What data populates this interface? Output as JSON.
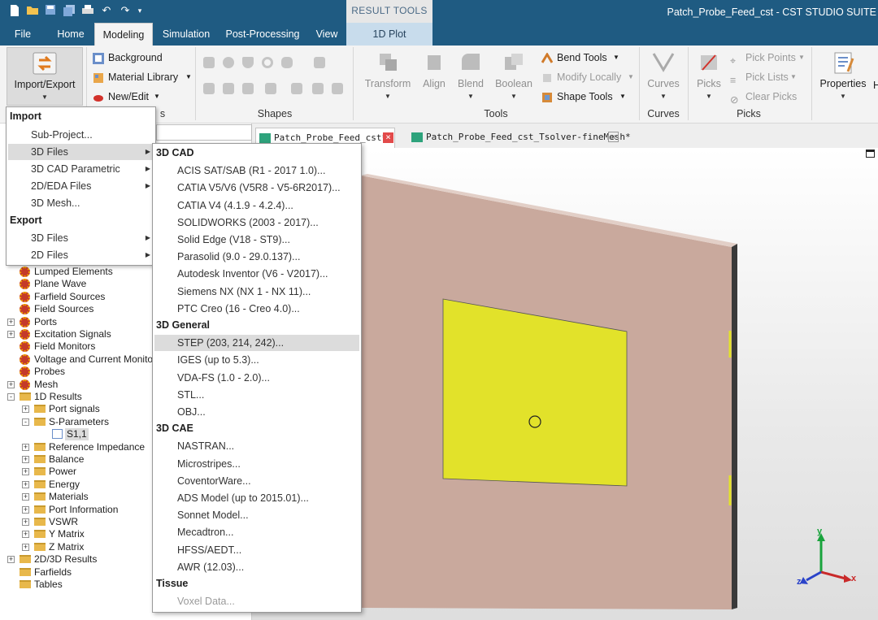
{
  "window": {
    "title": "Patch_Probe_Feed_cst - CST STUDIO SUITE"
  },
  "quick_access": [
    {
      "icon": "new-file-icon"
    },
    {
      "icon": "open-folder-icon"
    },
    {
      "icon": "save-icon"
    },
    {
      "icon": "save-all-icon"
    },
    {
      "icon": "print-icon"
    },
    {
      "icon": "undo-icon"
    },
    {
      "icon": "redo-icon"
    },
    {
      "icon": "customize-icon"
    }
  ],
  "menu": {
    "tabs": [
      "File",
      "Home",
      "Modeling",
      "Simulation",
      "Post-Processing",
      "View"
    ],
    "active": "Modeling"
  },
  "contextual": {
    "label": "RESULT TOOLS",
    "tab": "1D Plot"
  },
  "ribbon": {
    "import_export": "Import/Export",
    "materials": {
      "items": [
        "Background",
        "Material Library",
        "New/Edit"
      ],
      "group": "s"
    },
    "shapes": {
      "group": "Shapes"
    },
    "tools": {
      "group": "Tools",
      "transform": "Transform",
      "align": "Align",
      "blend": "Blend",
      "boolean": "Boolean",
      "bend_tools": "Bend Tools",
      "modify_locally": "Modify Locally",
      "shape_tools": "Shape Tools"
    },
    "curves": {
      "group": "Curves",
      "button": "Curves"
    },
    "picks": {
      "group": "Picks",
      "button": "Picks",
      "pick_points": "Pick Points",
      "pick_lists": "Pick Lists",
      "clear_picks": "Clear Picks"
    },
    "properties": "Properties",
    "overflow": "H"
  },
  "panel_close": "×",
  "tree": [
    {
      "label": "Lumped Elements",
      "icon": "gear-icon"
    },
    {
      "label": "Plane Wave",
      "icon": "gear-icon"
    },
    {
      "label": "Farfield Sources",
      "icon": "gear-icon"
    },
    {
      "label": "Field Sources",
      "icon": "gear-icon"
    },
    {
      "label": "Ports",
      "icon": "gear-icon",
      "exp": "+"
    },
    {
      "label": "Excitation Signals",
      "icon": "gear-icon",
      "exp": "+"
    },
    {
      "label": "Field Monitors",
      "icon": "gear-icon"
    },
    {
      "label": "Voltage and Current Monito",
      "icon": "gear-icon"
    },
    {
      "label": "Probes",
      "icon": "gear-icon"
    },
    {
      "label": "Mesh",
      "icon": "gear-icon",
      "exp": "+"
    },
    {
      "label": "1D Results",
      "icon": "folder-icon",
      "exp": "-"
    },
    {
      "label": "Port signals",
      "icon": "folder-icon",
      "exp": "+"
    },
    {
      "label": "S-Parameters",
      "icon": "folder-icon",
      "exp": "-"
    },
    {
      "label": "S1,1",
      "icon": "chart-icon"
    },
    {
      "label": "Reference Impedance",
      "icon": "folder-icon",
      "exp": "+"
    },
    {
      "label": "Balance",
      "icon": "folder-icon",
      "exp": "+"
    },
    {
      "label": "Power",
      "icon": "folder-icon",
      "exp": "+"
    },
    {
      "label": "Energy",
      "icon": "folder-icon",
      "exp": "+"
    },
    {
      "label": "Materials",
      "icon": "folder-icon",
      "exp": "+"
    },
    {
      "label": "Port Information",
      "icon": "folder-icon",
      "exp": "+"
    },
    {
      "label": "VSWR",
      "icon": "folder-icon",
      "exp": "+"
    },
    {
      "label": "Y Matrix",
      "icon": "folder-icon",
      "exp": "+"
    },
    {
      "label": "Z Matrix",
      "icon": "folder-icon",
      "exp": "+"
    },
    {
      "label": "2D/3D Results",
      "icon": "folder-icon",
      "exp": "+"
    },
    {
      "label": "Farfields",
      "icon": "folder-icon"
    },
    {
      "label": "Tables",
      "icon": "folder-icon"
    }
  ],
  "doc_tabs": [
    {
      "label": "Patch_Probe_Feed_cst*"
    },
    {
      "label": "Patch_Probe_Feed_cst_Tsolver-fineMesh*"
    }
  ],
  "axes": {
    "y": "y",
    "z": "z",
    "x": "x"
  },
  "colors": {
    "title_bar": "#1f5b82",
    "substrate": "#c9a99d",
    "patch": "#e2e22a",
    "highlight": "#dcdcdc"
  },
  "import_menu": {
    "import_header": "Import",
    "import_items": [
      "Sub-Project...",
      "3D Files",
      "3D CAD Parametric",
      "2D/EDA Files",
      "3D Mesh..."
    ],
    "export_header": "Export",
    "export_items": [
      "3D Files",
      "2D Files"
    ]
  },
  "submenu": {
    "cad_header": "3D CAD",
    "cad": [
      "ACIS SAT/SAB (R1 - 2017 1.0)...",
      "CATIA V5/V6 (V5R8 - V5-6R2017)...",
      "CATIA V4 (4.1.9 - 4.2.4)...",
      "SOLIDWORKS (2003 - 2017)...",
      "Solid Edge (V18 - ST9)...",
      "Parasolid (9.0 - 29.0.137)...",
      "Autodesk Inventor (V6 - V2017)...",
      "Siemens NX (NX 1 - NX 11)...",
      "PTC Creo (16 - Creo 4.0)..."
    ],
    "general_header": "3D General",
    "general": [
      "STEP (203, 214, 242)...",
      "IGES (up to 5.3)...",
      "VDA-FS (1.0 - 2.0)...",
      "STL...",
      "OBJ..."
    ],
    "cae_header": "3D CAE",
    "cae": [
      "NASTRAN...",
      "Microstripes...",
      "CoventorWare...",
      "ADS Model (up to 2015.01)...",
      "Sonnet Model...",
      "Mecadtron...",
      "HFSS/AEDT...",
      "AWR (12.03)..."
    ],
    "tissue_header": "Tissue",
    "tissue": [
      "Voxel Data..."
    ]
  }
}
